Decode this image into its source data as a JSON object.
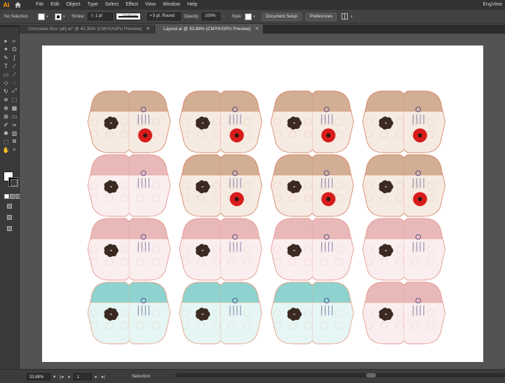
{
  "app": {
    "logo": "Ai",
    "workspace": "EngView"
  },
  "menu": [
    "File",
    "Edit",
    "Object",
    "Type",
    "Select",
    "Effect",
    "View",
    "Window",
    "Help"
  ],
  "control": {
    "selection_label": "No Selection",
    "stroke_label": "Stroke:",
    "stroke_weight": "1 pt",
    "profile": "Uniform",
    "brush": "5 pt. Round",
    "opacity_label": "Opacity:",
    "opacity_value": "100%",
    "style_label": "Style:",
    "document_setup": "Document Setup",
    "preferences": "Preferences"
  },
  "tabs": [
    {
      "label": "Chocolate Box (all).ai* @ 42.35% (CMYK/GPU Preview)",
      "active": false
    },
    {
      "label": "Layout.ai @ 33.88% (CMYK/GPU Preview)",
      "active": true
    }
  ],
  "status": {
    "zoom": "33.88%",
    "page": "1",
    "tool": "Selection"
  },
  "layout": {
    "rows": [
      [
        "brown",
        "brown",
        "brown",
        "brown"
      ],
      [
        "pink",
        "brown",
        "brown",
        "brown"
      ],
      [
        "pink",
        "pink",
        "pink",
        "pink"
      ],
      [
        "teal",
        "teal",
        "teal",
        "pink"
      ]
    ]
  },
  "palette": {
    "brown": {
      "band": "#d2ae94",
      "body": "#f6ebe2",
      "line": "#d9886c"
    },
    "pink": {
      "band": "#e9b9b9",
      "body": "#fbeeee",
      "line": "#e39a92"
    },
    "teal": {
      "band": "#8ed3cf",
      "body": "#e5f6f4",
      "line": "#e6a389"
    }
  }
}
